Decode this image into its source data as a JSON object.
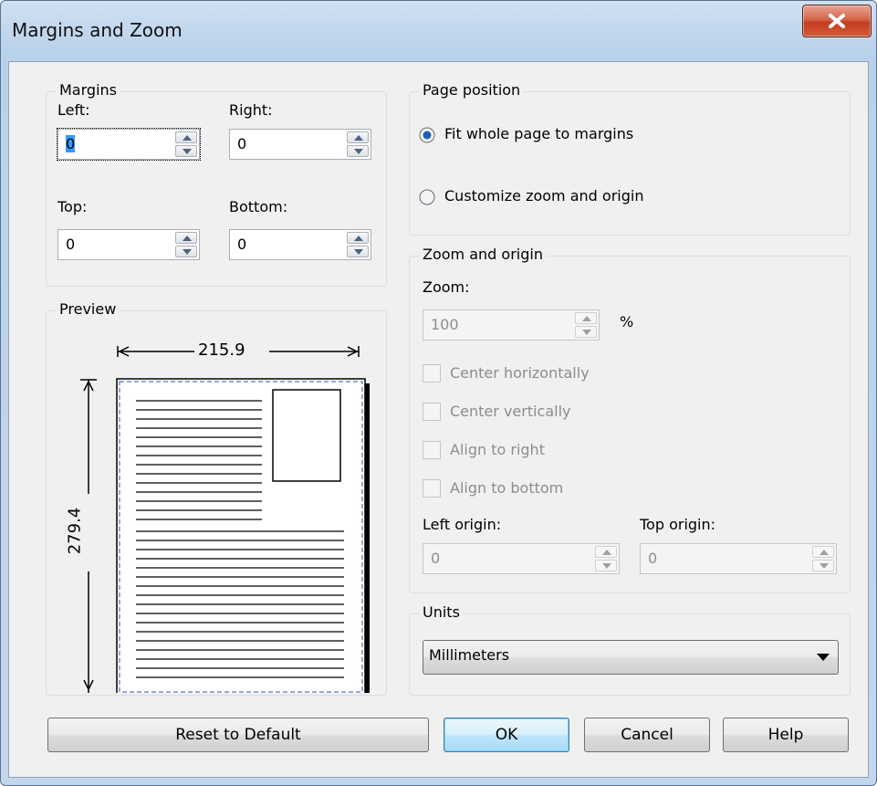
{
  "window": {
    "title": "Margins and Zoom"
  },
  "margins": {
    "legend": "Margins",
    "left": {
      "label": "Left:",
      "value": "0"
    },
    "right": {
      "label": "Right:",
      "value": "0"
    },
    "top": {
      "label": "Top:",
      "value": "0"
    },
    "bottom": {
      "label": "Bottom:",
      "value": "0"
    }
  },
  "preview": {
    "legend": "Preview",
    "width_label": "215.9",
    "height_label": "279.4"
  },
  "page_position": {
    "legend": "Page position",
    "options": [
      {
        "label": "Fit whole page to margins",
        "selected": true
      },
      {
        "label": "Customize zoom and origin",
        "selected": false
      }
    ]
  },
  "zoom_origin": {
    "legend": "Zoom and origin",
    "zoom_label": "Zoom:",
    "zoom_value": "100",
    "zoom_unit": "%",
    "checkboxes": [
      "Center horizontally",
      "Center vertically",
      "Align to right",
      "Align to bottom"
    ],
    "left_origin": {
      "label": "Left origin:",
      "value": "0"
    },
    "top_origin": {
      "label": "Top origin:",
      "value": "0"
    }
  },
  "units": {
    "legend": "Units",
    "selected": "Millimeters"
  },
  "buttons": {
    "reset": "Reset to Default",
    "ok": "OK",
    "cancel": "Cancel",
    "help": "Help"
  }
}
